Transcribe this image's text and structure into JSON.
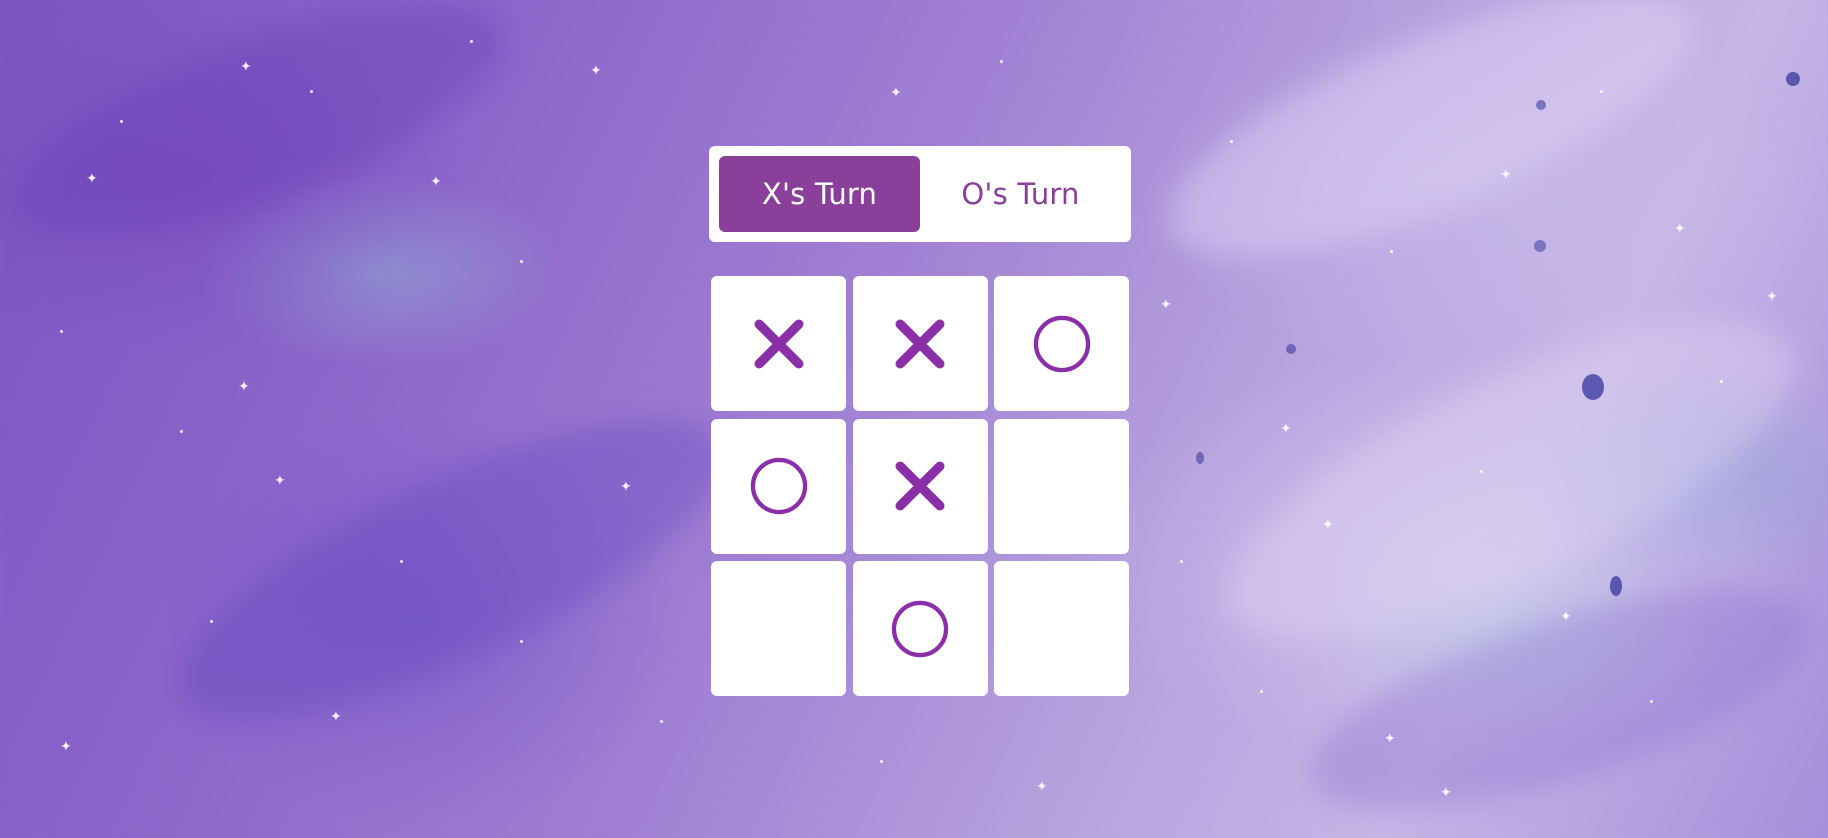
{
  "turn_indicator": {
    "x_label": "X's Turn",
    "o_label": "O's Turn",
    "active": "X"
  },
  "board": {
    "cells": [
      "X",
      "X",
      "O",
      "O",
      "X",
      "",
      "",
      "O",
      ""
    ]
  },
  "colors": {
    "accent": "#8a3f9a",
    "mark": "#8b2fa8",
    "panel": "#ffffff"
  }
}
